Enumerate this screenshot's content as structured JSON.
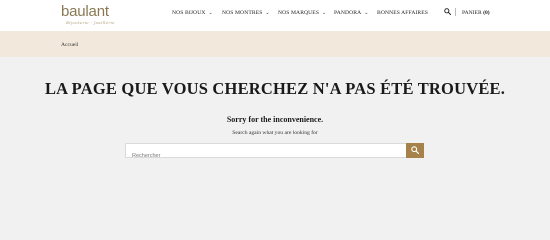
{
  "header": {
    "logo": {
      "name": "baulant",
      "tagline": "Bijouterie · Joaillerie"
    },
    "nav": [
      {
        "label": "NOS BIJOUX",
        "has_dropdown": true
      },
      {
        "label": "NOS MONTRES",
        "has_dropdown": true
      },
      {
        "label": "NOS MARQUES",
        "has_dropdown": true
      },
      {
        "label": "PANDORA",
        "has_dropdown": true
      },
      {
        "label": "BONNES AFFAIRES",
        "has_dropdown": false
      }
    ],
    "search_icon": "search-icon",
    "cart": {
      "label": "PANIER",
      "count": "(0)"
    }
  },
  "breadcrumb": {
    "home": "Accueil"
  },
  "main": {
    "title": "LA PAGE QUE VOUS CHERCHEZ N'A PAS ÉTÉ TROUVÉE.",
    "sorry": "Sorry for the inconvenience.",
    "hint": "Search again what you are looking for",
    "search": {
      "placeholder": "Rechercher",
      "value": ""
    }
  },
  "colors": {
    "accent": "#a6824a",
    "breadcrumb_bg": "#f2e9dc",
    "page_bg": "#f1f1f1",
    "logo": "#8a7a53"
  }
}
